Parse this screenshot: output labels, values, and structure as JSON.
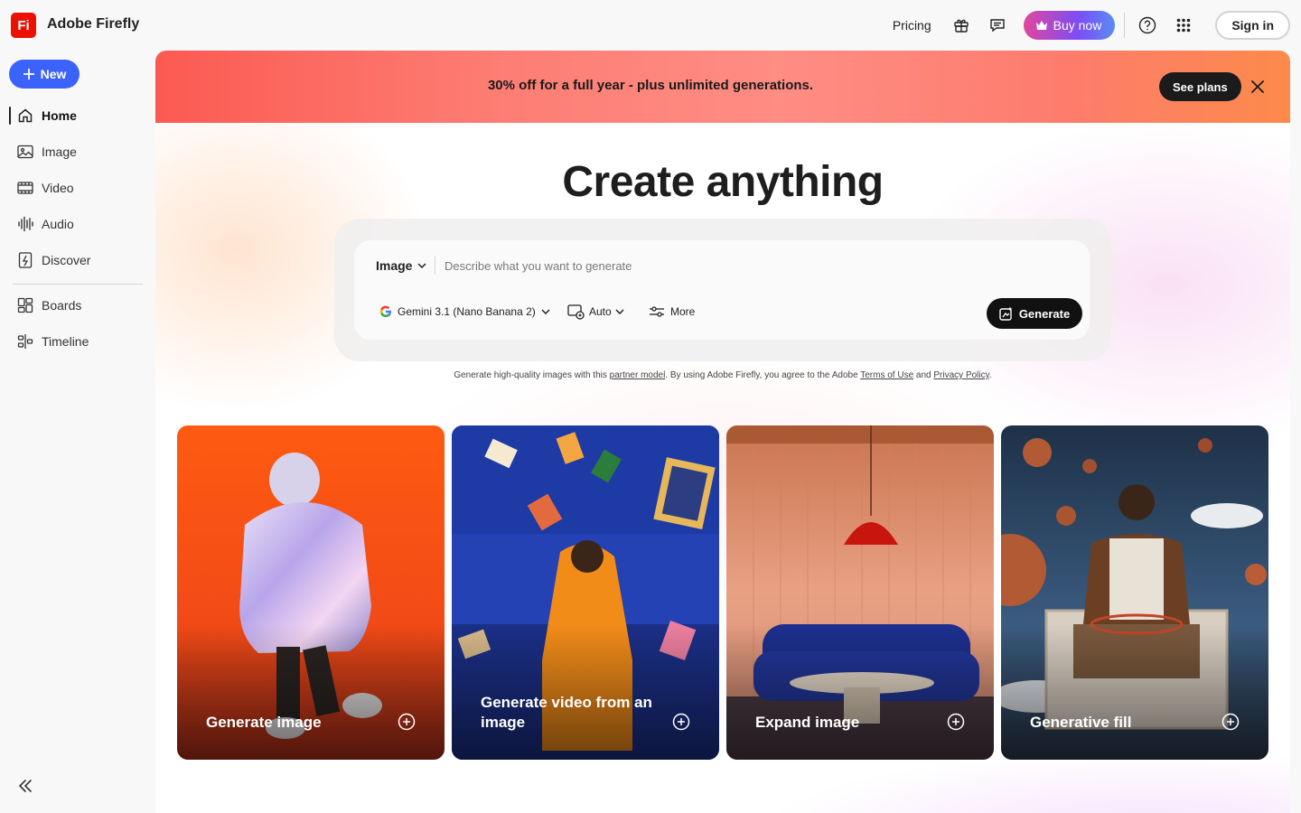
{
  "header": {
    "logo_text": "Fi",
    "app_name": "Adobe Firefly",
    "pricing": "Pricing",
    "buy_now": "Buy now",
    "sign_in": "Sign in",
    "icons": [
      "gift-icon",
      "chat-icon",
      "help-icon",
      "apps-grid-icon"
    ]
  },
  "sidebar": {
    "new_label": "New",
    "items": [
      {
        "label": "Home",
        "icon": "home-icon",
        "active": true
      },
      {
        "label": "Image",
        "icon": "image-icon"
      },
      {
        "label": "Video",
        "icon": "video-icon"
      },
      {
        "label": "Audio",
        "icon": "audio-icon"
      },
      {
        "label": "Discover",
        "icon": "discover-icon"
      },
      {
        "label": "Boards",
        "icon": "boards-icon"
      },
      {
        "label": "Timeline",
        "icon": "timeline-icon"
      }
    ]
  },
  "promo": {
    "text": "30% off for a full year - plus unlimited generations.",
    "cta": "See plans"
  },
  "hero": {
    "headline": "Create anything"
  },
  "prompt": {
    "type": "Image",
    "placeholder": "Describe what you want to generate",
    "model": "Gemini 3.1 (Nano Banana 2)",
    "ratio": "Auto",
    "more": "More",
    "generate": "Generate"
  },
  "disclaimer": {
    "part1": "Generate high-quality images with this ",
    "partner_link": "partner model",
    "part2": ". By using Adobe Firefly, you agree to the Adobe ",
    "terms_link": "Terms of Use",
    "part3": " and ",
    "privacy_link": "Privacy Policy",
    "part4": "."
  },
  "cards": [
    {
      "label": "Generate image"
    },
    {
      "label": "Generate video from an image"
    },
    {
      "label": "Expand image"
    },
    {
      "label": "Generative fill"
    }
  ],
  "colors": {
    "brand_red": "#eb1000",
    "new_button": "#3b63fb",
    "promo_start": "#fb5a52",
    "promo_end": "#fd8a4a"
  }
}
